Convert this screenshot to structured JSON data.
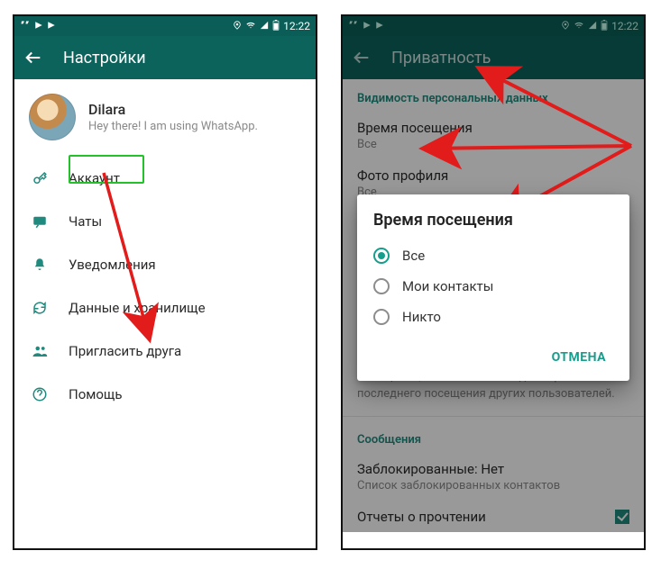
{
  "statusbar": {
    "time": "12:22"
  },
  "left": {
    "title": "Настройки",
    "profile": {
      "name": "Dilara",
      "status": "Hey there! I am using WhatsApp."
    },
    "items": [
      {
        "icon": "key-icon",
        "label": "Аккаунт"
      },
      {
        "icon": "chat-icon",
        "label": "Чаты"
      },
      {
        "icon": "bell-icon",
        "label": "Уведомления"
      },
      {
        "icon": "sync-icon",
        "label": "Данные и хранилище"
      },
      {
        "icon": "group-icon",
        "label": "Пригласить друга"
      },
      {
        "icon": "help-icon",
        "label": "Помощь"
      }
    ]
  },
  "right": {
    "title": "Приватность",
    "section1": "Видимость персональных данных",
    "prefs": [
      {
        "title": "Время посещения",
        "value": "Все"
      },
      {
        "title": "Фото профиля",
        "value": "Все"
      }
    ],
    "helper": "Если вы скроете время своего последнего посещения, то не сможете видеть время последнего посещения других пользователей.",
    "section2": "Сообщения",
    "blocked_title": "Заблокированные: Нет",
    "blocked_sub": "Список заблокированных контактов",
    "report_row": "Отчеты о прочтении"
  },
  "dialog": {
    "title": "Время посещения",
    "options": [
      {
        "label": "Все",
        "checked": true
      },
      {
        "label": "Мои контакты",
        "checked": false
      },
      {
        "label": "Никто",
        "checked": false
      }
    ],
    "cancel": "ОТМЕНА"
  }
}
